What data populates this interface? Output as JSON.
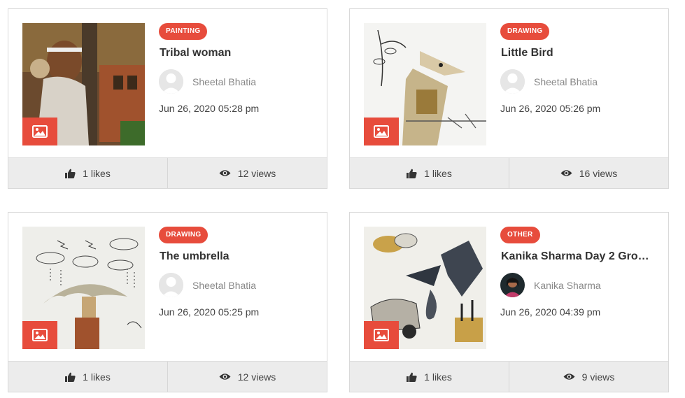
{
  "colors": {
    "accent": "#e74c3c",
    "footer_bg": "#ececec"
  },
  "cards": [
    {
      "category": "PAINTING",
      "title": "Tribal woman",
      "author": "Sheetal Bhatia",
      "date": "Jun 26, 2020 05:28 pm",
      "likes": "1 likes",
      "views": "12 views",
      "image_icon": "image-icon",
      "avatar": "default-avatar"
    },
    {
      "category": "DRAWING",
      "title": "Little Bird",
      "author": "Sheetal Bhatia",
      "date": "Jun 26, 2020 05:26 pm",
      "likes": "1 likes",
      "views": "16 views",
      "image_icon": "image-icon",
      "avatar": "default-avatar"
    },
    {
      "category": "DRAWING",
      "title": "The umbrella",
      "author": "Sheetal Bhatia",
      "date": "Jun 26, 2020 05:25 pm",
      "likes": "1 likes",
      "views": "12 views",
      "image_icon": "image-icon",
      "avatar": "default-avatar"
    },
    {
      "category": "OTHER",
      "title": "Kanika Sharma Day 2 Grou...",
      "author": "Kanika Sharma",
      "date": "Jun 26, 2020 04:39 pm",
      "likes": "1 likes",
      "views": "9 views",
      "image_icon": "image-icon",
      "avatar": "photo-avatar"
    }
  ]
}
